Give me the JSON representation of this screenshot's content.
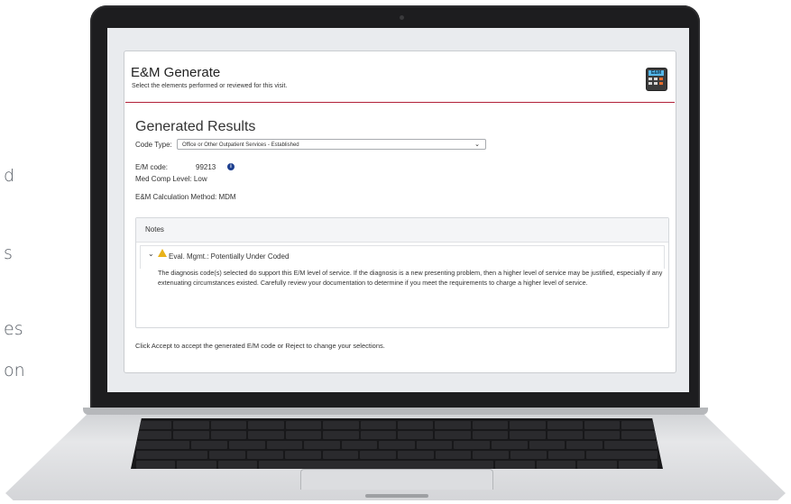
{
  "page_fragments": [
    "d",
    "s",
    "es",
    "on"
  ],
  "app": {
    "title": "E&M Generate",
    "subtitle": "Select the elements performed or reviewed for this visit.",
    "icon_label": "E&M",
    "icon": "calculator-icon",
    "accent_color": "#b1213a"
  },
  "results": {
    "heading": "Generated Results",
    "code_type_label": "Code Type:",
    "code_type_value": "Office or Other Outpatient Services - Established",
    "em_code_label": "E/M code:",
    "em_code_value": "99213",
    "med_comp_label": "Med Comp Level: Low",
    "calc_method_label": "E&M Calculation Method: MDM"
  },
  "notes": {
    "header": "Notes",
    "item_title": "Eval. Mgmt.: Potentially Under Coded",
    "item_body": "The diagnosis code(s) selected do support this E/M level of service. If the diagnosis is a new presenting problem, then a higher level of service may be justified, especially if any extenuating circumstances existed. Carefully review your documentation to determine if you meet the requirements to charge a higher level of service.",
    "warning_color": "#e8b21a"
  },
  "footer": {
    "text": "Click Accept to accept the generated E/M code or Reject to change your selections."
  }
}
